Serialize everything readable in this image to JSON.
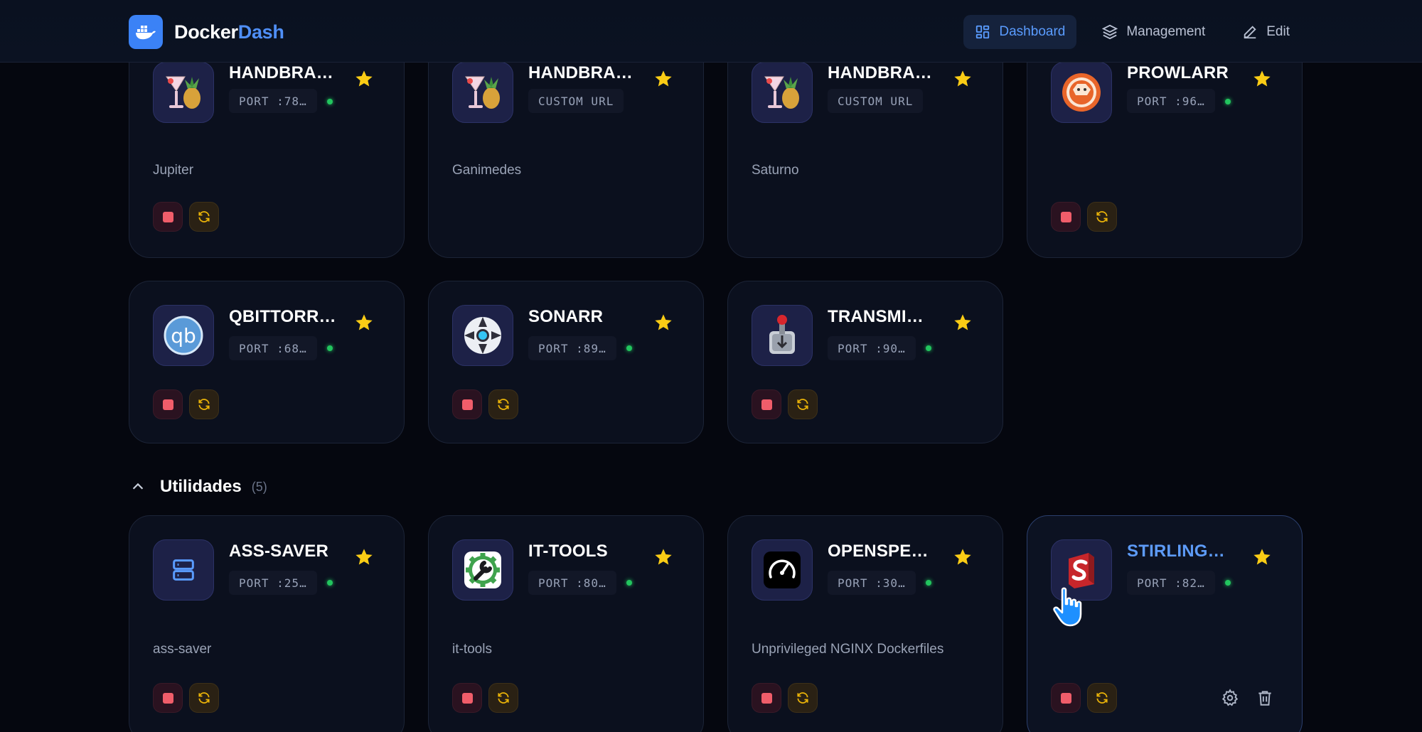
{
  "header": {
    "brand_part1": "Docker",
    "brand_part2": "Dash",
    "nav": [
      {
        "label": "Dashboard",
        "icon": "grid-icon",
        "active": true
      },
      {
        "label": "Management",
        "icon": "layers-icon",
        "active": false
      },
      {
        "label": "Edit",
        "icon": "pencil-icon",
        "active": false
      }
    ]
  },
  "cards_top": [
    {
      "name": "HANDBRA…",
      "port": "PORT :78…",
      "status": "running",
      "desc": "Jupiter",
      "icon": "handbrake-icon"
    },
    {
      "name": "HANDBRA…",
      "port": "CUSTOM URL",
      "status": "none",
      "desc": "Ganimedes",
      "icon": "handbrake-icon"
    },
    {
      "name": "HANDBRA…",
      "port": "CUSTOM URL",
      "status": "none",
      "desc": "Saturno",
      "icon": "handbrake-icon"
    },
    {
      "name": "PROWLARR",
      "port": "PORT :96…",
      "status": "running",
      "desc": "",
      "icon": "prowlarr-icon"
    },
    {
      "name": "QBITTORR…",
      "port": "PORT :68…",
      "status": "running",
      "desc": "",
      "icon": "qbittorrent-icon"
    },
    {
      "name": "SONARR",
      "port": "PORT :89…",
      "status": "running",
      "desc": "",
      "icon": "sonarr-icon"
    },
    {
      "name": "TRANSMI…",
      "port": "PORT :90…",
      "status": "running",
      "desc": "",
      "icon": "transmission-icon"
    }
  ],
  "section": {
    "title": "Utilidades",
    "count": "(5)"
  },
  "cards_util": [
    {
      "name": "ASS-SAVER",
      "port": "PORT :25…",
      "status": "running",
      "desc": "ass-saver",
      "icon": "server-icon"
    },
    {
      "name": "IT-TOOLS",
      "port": "PORT :80…",
      "status": "running",
      "desc": "it-tools",
      "icon": "it-tools-icon"
    },
    {
      "name": "OPENSPE…",
      "port": "PORT :30…",
      "status": "running",
      "desc": "Unprivileged NGINX Dockerfiles",
      "icon": "speedometer-icon"
    },
    {
      "name": "STIRLING…",
      "port": "PORT :82…",
      "status": "running",
      "desc": "",
      "icon": "stirling-pdf-icon"
    }
  ],
  "colors": {
    "accent": "#4f8ff7",
    "stop": "#f05d6a",
    "restart": "#eab308",
    "status_running": "#22c55e",
    "star": "#facc15"
  }
}
